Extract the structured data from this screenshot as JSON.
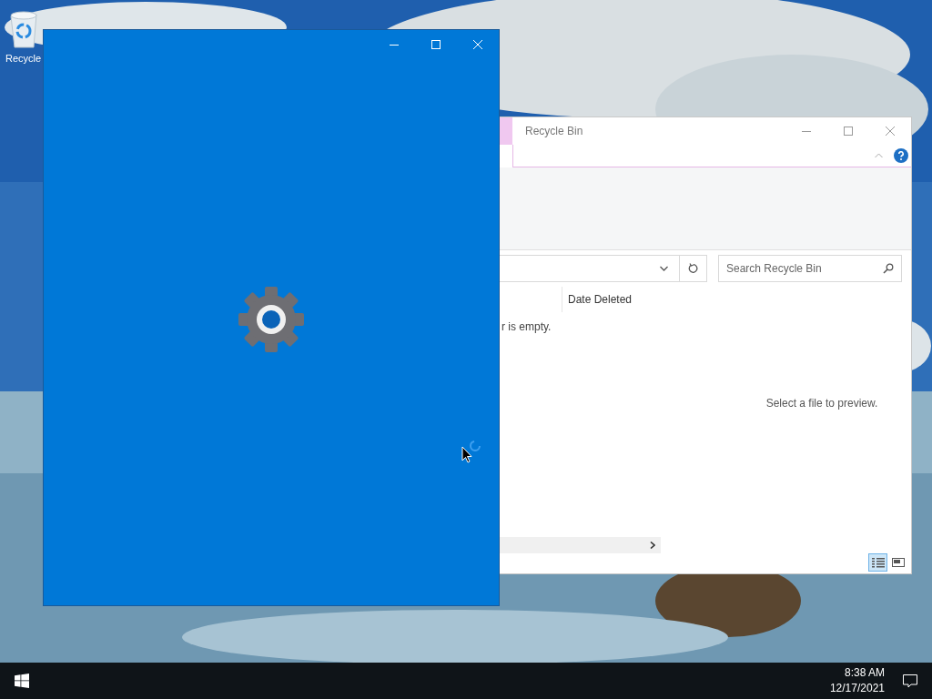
{
  "desktop": {
    "icons": [
      {
        "label": "Recycle"
      }
    ]
  },
  "explorer": {
    "title": "Recycle Bin",
    "search": {
      "placeholder": "Search Recycle Bin"
    },
    "columns": [
      "Date Deleted"
    ],
    "empty_message": "r is empty.",
    "preview_message": "Select a file to preview.",
    "view_buttons": [
      {
        "kind": "details",
        "selected": true
      },
      {
        "kind": "large-icons",
        "selected": false
      }
    ]
  },
  "taskbar": {
    "time": "8:38 AM",
    "date": "12/17/2021"
  }
}
